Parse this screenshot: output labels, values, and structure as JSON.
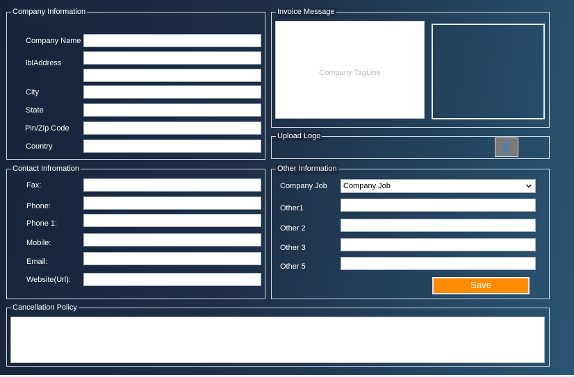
{
  "company": {
    "title": "Company Information",
    "fields": [
      {
        "label": "Company Name",
        "value": ""
      },
      {
        "label": "lblAddress",
        "value": ""
      },
      {
        "label": "City",
        "value": ""
      },
      {
        "label": "State",
        "value": ""
      },
      {
        "label": "Pin/Zip Code",
        "value": ""
      },
      {
        "label": "Country",
        "value": ""
      }
    ],
    "address_line2": ""
  },
  "invoice": {
    "title": "Invoice Message",
    "tagline_placeholder": "Company TagLine"
  },
  "upload": {
    "title": "Upload Logo",
    "attach_icon": "paperclip-icon"
  },
  "contact": {
    "title": "Contact Infromation",
    "fields": [
      {
        "label": "Fax:",
        "value": ""
      },
      {
        "label": "Phone:",
        "value": ""
      },
      {
        "label": "Phone 1:",
        "value": ""
      },
      {
        "label": "Mobile:",
        "value": ""
      },
      {
        "label": "Email:",
        "value": ""
      },
      {
        "label": "Website(Url):",
        "value": ""
      }
    ]
  },
  "other": {
    "title": "Other Information",
    "job_label": "Company Job",
    "job_selected": "Company Job",
    "fields": [
      {
        "label": "Other1",
        "value": ""
      },
      {
        "label": "Other 2",
        "value": ""
      },
      {
        "label": "Other 3",
        "value": ""
      },
      {
        "label": "Other 5",
        "value": ""
      }
    ],
    "save_label": "Save"
  },
  "cancellation": {
    "title": "Cancellation Policy",
    "value": ""
  },
  "colors": {
    "accent": "#ff8c00",
    "background_start": "#16223a",
    "background_end": "#2a5572"
  }
}
